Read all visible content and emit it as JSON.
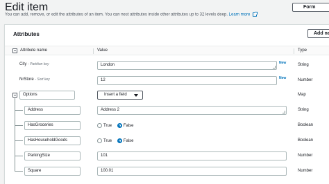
{
  "page": {
    "title": "Edit item",
    "form_button": "Form",
    "description": "You can add, remove, or edit the attributes of an item. You can nest attributes inside other attributes up to 32 levels deep.",
    "learn_more": "Learn more"
  },
  "attributes": {
    "panel_title": "Attributes",
    "add_new_label": "Add new",
    "columns": {
      "name": "Attribute name",
      "value": "Value",
      "type": "Type"
    },
    "rows": [
      {
        "name": "City",
        "key_note": "- Partition key",
        "value": "London",
        "badge": "New",
        "type": "String"
      },
      {
        "name": "NrStore",
        "key_note": "- Sort key",
        "value": "12",
        "badge": "New",
        "type": "Number"
      }
    ],
    "options": {
      "name": "Options",
      "insert_label": "Insert a field",
      "type": "Map",
      "children": [
        {
          "name": "Address",
          "value": "Address 2",
          "type": "String"
        },
        {
          "name": "HasGroceries",
          "true_label": "True",
          "false_label": "False",
          "selected": "False",
          "type": "Boolean"
        },
        {
          "name": "HasHouseholdGoods",
          "true_label": "True",
          "false_label": "False",
          "selected": "False",
          "type": "Boolean"
        },
        {
          "name": "ParkingSize",
          "value": "101",
          "type": "Number"
        },
        {
          "name": "Square",
          "value": "100.01",
          "type": "Number"
        }
      ]
    }
  },
  "colors": {
    "accent": "#0073bb",
    "border": "#aab7b8",
    "background": "#f2f3f3"
  }
}
